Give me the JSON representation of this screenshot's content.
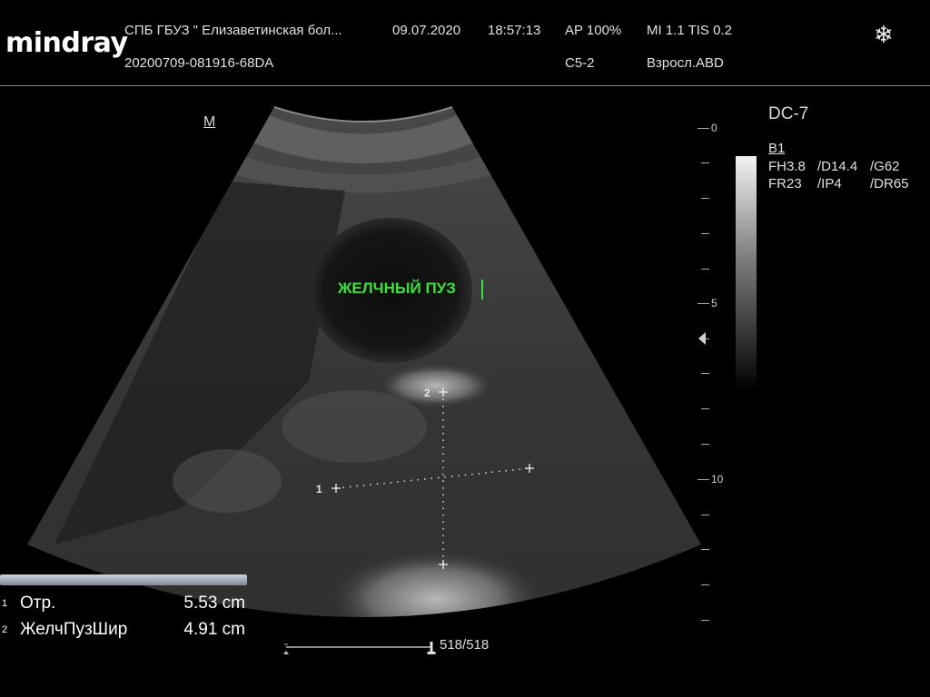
{
  "header": {
    "logo": "mindray",
    "institution": "СПБ  ГБУЗ \" Елизаветинская бол...",
    "date": "09.07.2020",
    "time": "18:57:13",
    "ap": "AP  100%",
    "mi_tis": "MI 1.1 TIS 0.2",
    "exam_id": "20200709-081916-68DA",
    "probe": "C5-2",
    "exam_preset": "Взросл.ABD",
    "freeze_icon": "snowflake-icon"
  },
  "image": {
    "orientation_marker": "M",
    "annotation": "ЖЕЛЧНЫЙ ПУЗ",
    "caliper_points": [
      "1",
      "2"
    ]
  },
  "depth_scale": {
    "labels": [
      "0",
      "5",
      "10"
    ]
  },
  "params": {
    "preset": "DC-7",
    "mode": "B1",
    "row1": [
      "FH3.8",
      "/D14.4",
      "/G62"
    ],
    "row2": [
      "FR23",
      "/IP4",
      "/DR65"
    ]
  },
  "measurements": [
    {
      "index": "1",
      "name": "Отр.",
      "value": "5.53 cm"
    },
    {
      "index": "2",
      "name": "ЖелчПузШир",
      "value": "4.91 cm"
    }
  ],
  "cine": {
    "frame_counter": "518/518",
    "position_fraction": 1.0
  }
}
